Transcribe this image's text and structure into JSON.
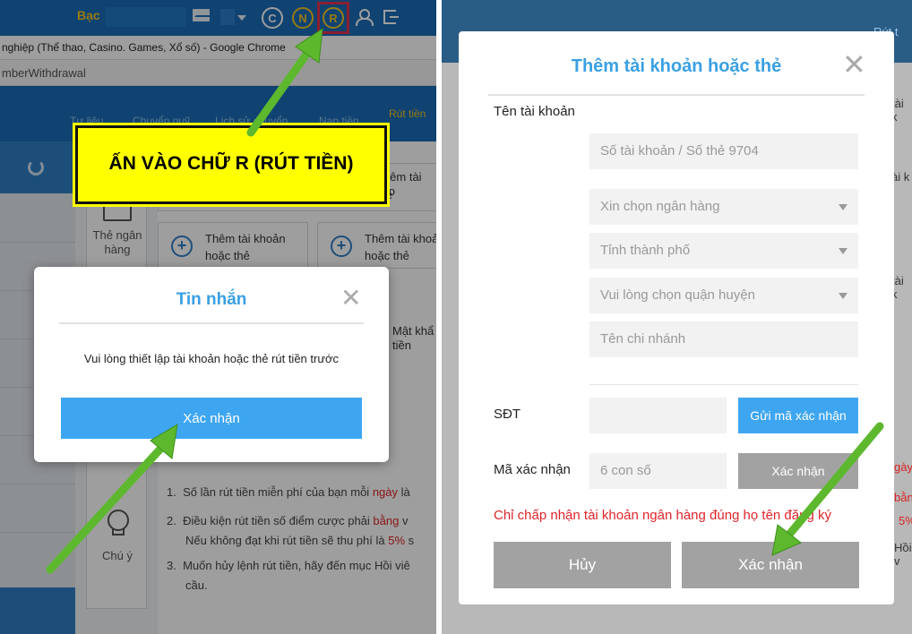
{
  "left": {
    "topbar": {
      "currency": "Bạc",
      "icons": [
        "C",
        "N",
        "R"
      ]
    },
    "browser_title": "nghiệp (Thể thao, Casino. Games, Xổ số) - Google Chrome",
    "url": "mberWithdrawal",
    "nav_tabs": [
      "Tư liệu",
      "Chuyển quỹ",
      "Lịch sử chuyển",
      "Nạp tiền",
      "Rút tiền"
    ],
    "bank_label": "Thẻ ngân hàng",
    "cards": [
      "Thêm tài khoản hoặc thẻ",
      "Thêm tài khoản hoặc thẻ"
    ],
    "side_fragments": [
      "Thêm tài kho",
      "thẻ",
      "Mật khẩ",
      "tiền"
    ],
    "note_label": "Chú ý",
    "notes": [
      {
        "num": "1.",
        "text": "Số lần rút tiền miễn phí của bạn mỗi",
        "red": "ngày",
        "tail": "là"
      },
      {
        "num": "2.",
        "text": "Điều kiện rút tiền số điểm cược phải",
        "red": "bằng",
        "tail": "v"
      },
      {
        "num": "",
        "text": "Nếu không đạt khi rút tiền sẽ thu phí là",
        "red": "5%",
        "tail": "s"
      },
      {
        "num": "3.",
        "text": "Muốn hủy lệnh rút tiền, hãy đến mục Hồi viê",
        "red": "",
        "tail": ""
      },
      {
        "num": "",
        "text": "cầu.",
        "red": "",
        "tail": ""
      }
    ],
    "callout": "ẤN VÀO CHỮ R (RÚT TIỀN)",
    "modal": {
      "title": "Tin nhắn",
      "close": "✕",
      "message": "Vui lòng thiết lập tài khoản hoặc thẻ rút tiền trước",
      "confirm": "Xác nhận"
    }
  },
  "right": {
    "bg_fragments": [
      "Rút t",
      "tài k",
      "ài k",
      "tài k",
      "gày",
      "bằng",
      "5%",
      "Hồi v"
    ],
    "modal": {
      "title": "Thêm tài khoản hoặc thẻ",
      "close": "✕",
      "account_name_label": "Tên tài khoản",
      "account_number_placeholder": "Số tài khoản / Số thẻ 9704",
      "bank_placeholder": "Xin chọn ngân hàng",
      "city_placeholder": "Tỉnh thành phố",
      "district_placeholder": "Vui lòng chọn quận huyện",
      "branch_placeholder": "Tên chi nhánh",
      "phone_label": "SĐT",
      "send_code": "Gửi mã xác nhận",
      "code_label": "Mã xác nhận",
      "code_placeholder": "6 con số",
      "verify": "Xác nhận",
      "warning": "Chỉ chấp nhận tài khoản ngân hàng đúng họ tên đăng ký",
      "cancel": "Hủy",
      "confirm": "Xác nhận"
    }
  },
  "colors": {
    "accent": "#3ea6f0",
    "title": "#3aa0e3",
    "warning": "#e0252b",
    "callout": "#ffff00",
    "arrow": "#5db82e",
    "highlight_box": "#e0334f"
  }
}
